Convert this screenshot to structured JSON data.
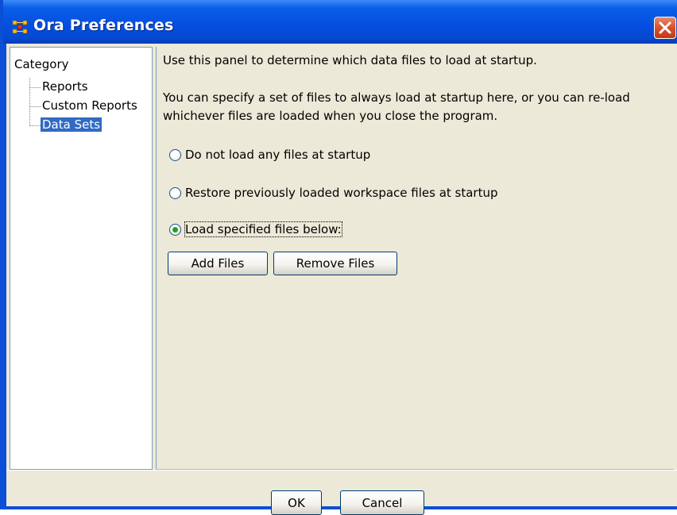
{
  "window": {
    "title": "Ora Preferences"
  },
  "sidebar": {
    "root_label": "Category",
    "items": [
      {
        "label": "Reports",
        "selected": false
      },
      {
        "label": "Custom Reports",
        "selected": false
      },
      {
        "label": "Data Sets",
        "selected": true
      }
    ]
  },
  "panel": {
    "description_1": "Use this panel to determine which data files to load at startup.",
    "description_2a": "You can specify a set of files to always load at startup here, or you can re-load",
    "description_2b": "whichever files are loaded when you close the program.",
    "options": [
      {
        "label": "Do not load any files at startup",
        "checked": false
      },
      {
        "label": "Restore previously loaded workspace files at startup",
        "checked": false
      },
      {
        "label": "Load specified files below:",
        "checked": true
      }
    ],
    "add_files_label": "Add Files",
    "remove_files_label": "Remove Files"
  },
  "footer": {
    "ok_label": "OK",
    "cancel_label": "Cancel"
  },
  "colors": {
    "title_bar": "#0550e0",
    "dialog_bg": "#ece9d8",
    "selection": "#316ac5",
    "radio_dot": "#21a121",
    "close_button": "#d8522c"
  },
  "icons": [
    "ora-app-icon",
    "close-icon",
    "radio-icon"
  ]
}
